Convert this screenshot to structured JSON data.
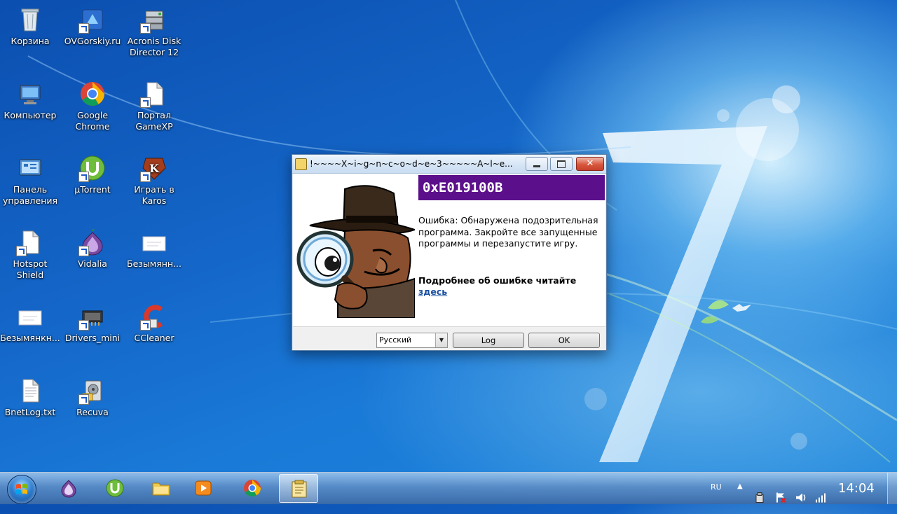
{
  "desktop": {
    "icons": [
      {
        "label": "Корзина",
        "icon": "recycle-bin-icon"
      },
      {
        "label": "OVGorskiy.ru",
        "icon": "website-shortcut-icon"
      },
      {
        "label": "Acronis Disk Director 12",
        "icon": "acronis-icon"
      },
      {
        "label": "Компьютер",
        "icon": "computer-icon"
      },
      {
        "label": "Google Chrome",
        "icon": "chrome-icon"
      },
      {
        "label": "Портал GameXP",
        "icon": "file-shortcut-icon"
      },
      {
        "label": "Панель управления",
        "icon": "control-panel-icon"
      },
      {
        "label": "µTorrent",
        "icon": "utorrent-icon"
      },
      {
        "label": "Играть в Karos",
        "icon": "karos-icon"
      },
      {
        "label": "Hotspot Shield",
        "icon": "file-shortcut-icon"
      },
      {
        "label": "Vidalia",
        "icon": "onion-icon"
      },
      {
        "label": "Безымянн...",
        "icon": "blank-doc-icon"
      },
      {
        "label": "Безымянкн...",
        "icon": "blank-doc-icon"
      },
      {
        "label": "Drivers_mini",
        "icon": "drivers-icon"
      },
      {
        "label": "CCleaner",
        "icon": "ccleaner-icon"
      },
      {
        "label": "BnetLog.txt",
        "icon": "text-file-icon"
      },
      {
        "label": "Recuva",
        "icon": "recuva-icon"
      }
    ]
  },
  "dialog": {
    "title": "!~~~~X~i~g~n~c~o~d~e~3~~~~~A~l~e...",
    "error_code": "0xE019100B",
    "message": "Ошибка: Обнаружена подозрительная программа. Закройте все запущенные программы и перезапустите игру.",
    "more_info": "Подробнее об ошибке читайте",
    "link_text": "здесь",
    "language_value": "Русский",
    "log_label": "Log",
    "ok_label": "OK",
    "colors": {
      "error_band": "#5c0f8b",
      "link": "#1a4fa0"
    }
  },
  "taskbar": {
    "pinned": [
      "start-orb",
      "onion-icon",
      "utorrent-icon",
      "folder-icon",
      "media-player-icon",
      "chrome-icon",
      "xigncode-dialog-icon"
    ],
    "lang": "RU",
    "clock": "14:04"
  }
}
